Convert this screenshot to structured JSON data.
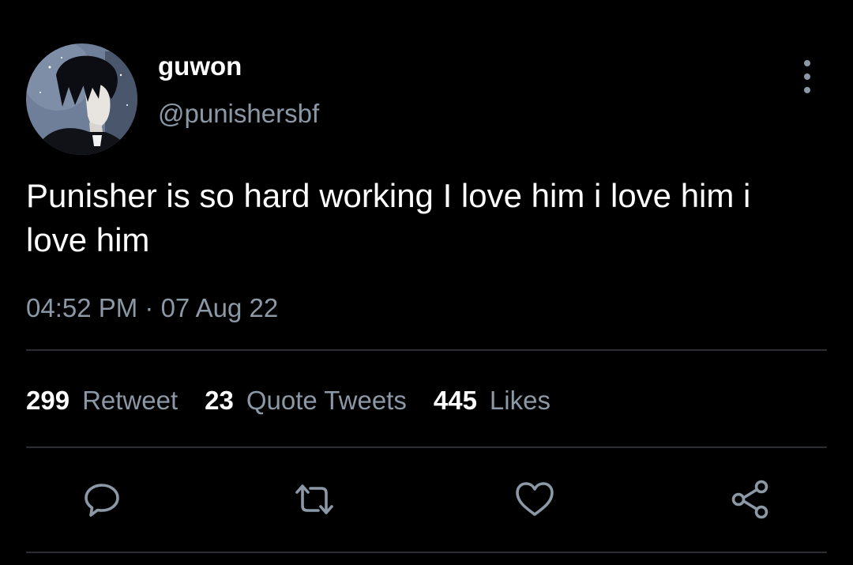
{
  "tweet": {
    "display_name": "guwon",
    "handle": "@punishersbf",
    "text": "Punisher is so hard working I love him i love him i love him",
    "timestamp": "04:52 PM · 07 Aug 22"
  },
  "stats": [
    {
      "count": "299",
      "label": "Retweet"
    },
    {
      "count": "23",
      "label": "Quote Tweets"
    },
    {
      "count": "445",
      "label": "Likes"
    }
  ],
  "actions": [
    "reply-icon",
    "retweet-icon",
    "like-icon",
    "share-icon"
  ],
  "colors": {
    "background": "#000000",
    "text_primary": "#ffffff",
    "text_secondary": "#8b98a5",
    "divider": "#2a2d31"
  }
}
